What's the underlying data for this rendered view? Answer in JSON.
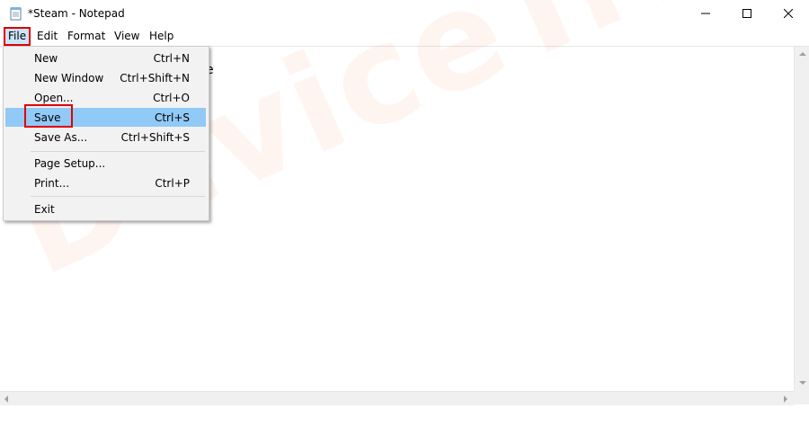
{
  "window": {
    "title": "*Steam - Notepad",
    "controls": {
      "minimize": "minimize-icon",
      "maximize": "maximize-icon",
      "close": "close-icon"
    }
  },
  "menubar": {
    "items": [
      "File",
      "Edit",
      "Format",
      "View",
      "Help"
    ]
  },
  "editor": {
    "visible_text": "e"
  },
  "file_menu": {
    "items": [
      {
        "label": "New",
        "shortcut": "Ctrl+N"
      },
      {
        "label": "New Window",
        "shortcut": "Ctrl+Shift+N"
      },
      {
        "label": "Open...",
        "shortcut": "Ctrl+O"
      },
      {
        "label": "Save",
        "shortcut": "Ctrl+S"
      },
      {
        "label": "Save As...",
        "shortcut": "Ctrl+Shift+S"
      },
      {
        "label": "Page Setup...",
        "shortcut": ""
      },
      {
        "label": "Print...",
        "shortcut": "Ctrl+P"
      },
      {
        "label": "Exit",
        "shortcut": ""
      }
    ],
    "highlighted_item": "Save"
  },
  "watermark": {
    "text": "DeviceTricks"
  },
  "colors": {
    "highlight": "#91c9f7",
    "annotation_red": "#e00000",
    "watermark": "#f4783c"
  }
}
